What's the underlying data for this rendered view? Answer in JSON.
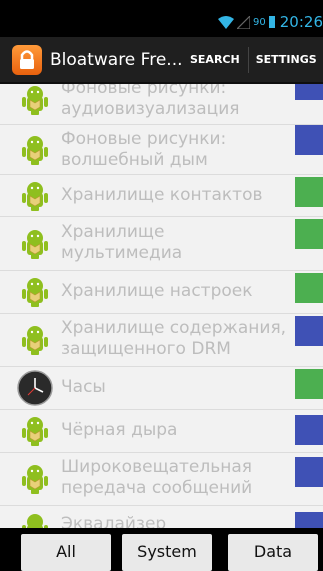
{
  "status_bar": {
    "battery_level": "90",
    "time": "20:26"
  },
  "action_bar": {
    "title": "Bloatware Fre...",
    "search_label": "SEARCH",
    "settings_label": "SETTINGS"
  },
  "list": {
    "items": [
      {
        "label": "Фоновые рисунки:\nаудиовизуализация",
        "icon": "android-icon",
        "status_color": "#3f51b5"
      },
      {
        "label": "Фоновые рисунки:\nволшебный дым",
        "icon": "android-icon",
        "status_color": "#3f51b5"
      },
      {
        "label": "Хранилище контактов",
        "icon": "android-icon",
        "status_color": "#4caf50"
      },
      {
        "label": "Хранилище\nмультимедиа",
        "icon": "android-icon",
        "status_color": "#4caf50"
      },
      {
        "label": "Хранилище настроек",
        "icon": "android-icon",
        "status_color": "#4caf50"
      },
      {
        "label": "Хранилище содержания,\nзащищенного DRM",
        "icon": "android-icon",
        "status_color": "#3f51b5"
      },
      {
        "label": "Часы",
        "icon": "clock-icon",
        "status_color": "#4caf50"
      },
      {
        "label": "Чёрная дыра",
        "icon": "android-icon",
        "status_color": "#3f51b5"
      },
      {
        "label": "Широковещательная\nпередача сообщений",
        "icon": "android-icon",
        "status_color": "#3f51b5"
      },
      {
        "label": "Эквалайзер",
        "icon": "android-icon",
        "status_color": "#3f51b5"
      }
    ]
  },
  "tabs": {
    "all_label": "All",
    "system_label": "System",
    "data_label": "Data"
  }
}
